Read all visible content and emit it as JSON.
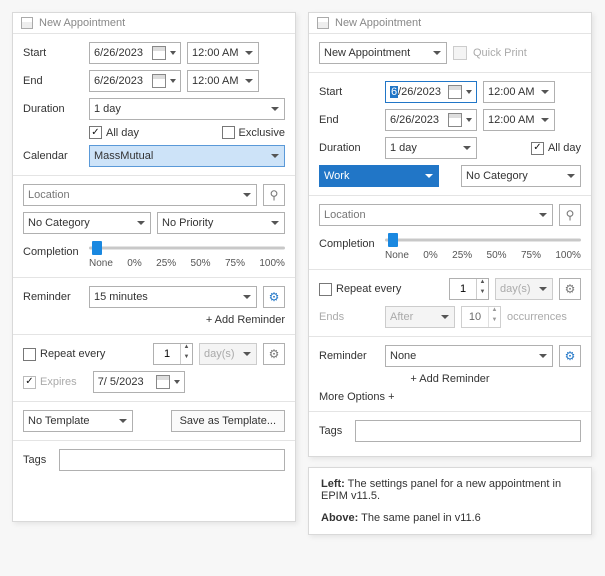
{
  "left": {
    "title": "New Appointment",
    "start_label": "Start",
    "end_label": "End",
    "duration_label": "Duration",
    "calendar_label": "Calendar",
    "date": "6/26/2023",
    "time": "12:00 AM",
    "duration_value": "1 day",
    "allday_label": "All day",
    "exclusive_label": "Exclusive",
    "calendar_value": "MassMutual",
    "location_placeholder": "Location",
    "category_value": "No Category",
    "priority_value": "No Priority",
    "completion_label": "Completion",
    "ticks": [
      "None",
      "0%",
      "25%",
      "50%",
      "75%",
      "100%"
    ],
    "reminder_label": "Reminder",
    "reminder_value": "15 minutes",
    "add_reminder": "+ Add Reminder",
    "repeat_label": "Repeat every",
    "repeat_n": "1",
    "repeat_unit": "day(s)",
    "expires_label": "Expires",
    "expires_date": "7/ 5/2023",
    "template_value": "No Template",
    "save_template": "Save as Template...",
    "tags_label": "Tags"
  },
  "right": {
    "title": "New Appointment",
    "type_value": "New Appointment",
    "quickprint": "Quick Print",
    "start_label": "Start",
    "end_label": "End",
    "duration_label": "Duration",
    "date_month_sel": "6",
    "date_rest": "/26/2023",
    "date_full": "6/26/2023",
    "time": "12:00 AM",
    "duration_value": "1 day",
    "allday_label": "All day",
    "cal_value": "Work",
    "category_value": "No Category",
    "location_placeholder": "Location",
    "completion_label": "Completion",
    "ticks": [
      "None",
      "0%",
      "25%",
      "50%",
      "75%",
      "100%"
    ],
    "repeat_label": "Repeat every",
    "repeat_n": "1",
    "repeat_unit": "day(s)",
    "ends_label": "Ends",
    "ends_value": "After",
    "ends_n": "10",
    "ends_unit": "occurrences",
    "reminder_label": "Reminder",
    "reminder_value": "None",
    "add_reminder": "+ Add Reminder",
    "more_options": "More Options +",
    "tags_label": "Tags"
  },
  "note": {
    "left_b": "Left:",
    "left_t": " The settings panel for a new appointment in EPIM v11.5.",
    "above_b": "Above:",
    "above_t": " The same panel in v11.6"
  }
}
